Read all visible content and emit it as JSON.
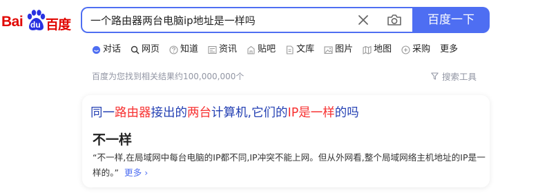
{
  "logo": {
    "text_bai": "Bai",
    "text_du": "du",
    "text_cn": "百度",
    "color": "#e10601"
  },
  "search": {
    "query": "一个路由器两台电脑ip地址是一样吗",
    "button_label": "百度一下",
    "accent": "#4e6ef2"
  },
  "tabs": [
    {
      "label": "对话",
      "icon": "chat-icon"
    },
    {
      "label": "网页",
      "icon": "search-icon",
      "active": true
    },
    {
      "label": "知道",
      "icon": "question-icon"
    },
    {
      "label": "资讯",
      "icon": "news-icon"
    },
    {
      "label": "贴吧",
      "icon": "tieba-icon"
    },
    {
      "label": "文库",
      "icon": "doc-icon"
    },
    {
      "label": "图片",
      "icon": "image-icon"
    },
    {
      "label": "地图",
      "icon": "map-icon"
    },
    {
      "label": "采购",
      "icon": "purchase-icon"
    },
    {
      "label": "更多",
      "icon": ""
    }
  ],
  "stats": {
    "result_count": "百度为您找到相关结果约100,000,000个",
    "tools_label": "搜索工具"
  },
  "result": {
    "title_parts": [
      {
        "text": "同一",
        "hl": false
      },
      {
        "text": "路由器",
        "hl": true
      },
      {
        "text": "接出的",
        "hl": false
      },
      {
        "text": "两台",
        "hl": true
      },
      {
        "text": "计算机,它们的",
        "hl": false
      },
      {
        "text": "IP是一样",
        "hl": true
      },
      {
        "text": "的吗",
        "hl": false
      }
    ],
    "answer": "不一样",
    "snippet": "“不一样,在局域网中每台电脑的IP都不同,IP冲突不能上网。但从外网看,整个局域网络主机地址的IP是一样的。”",
    "more_label": "更多"
  }
}
